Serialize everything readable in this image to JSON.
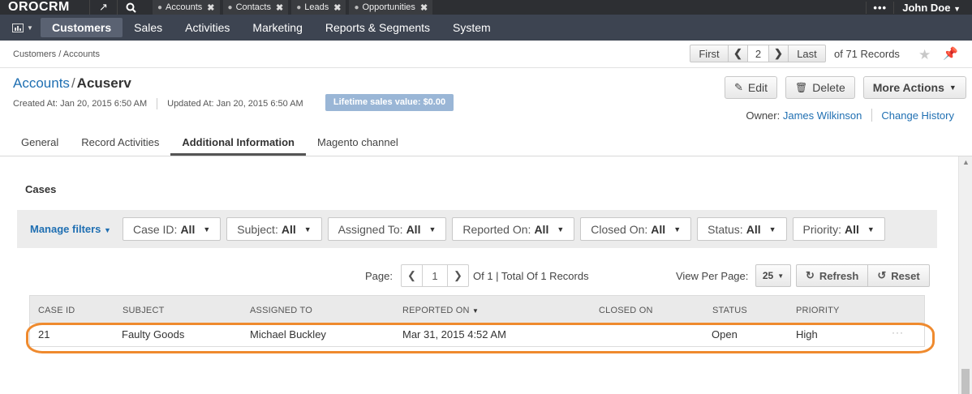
{
  "topbar": {
    "logo": "OROCRM",
    "pins": [
      {
        "label": "Accounts"
      },
      {
        "label": "Contacts"
      },
      {
        "label": "Leads"
      },
      {
        "label": "Opportunities"
      }
    ],
    "user": "John Doe"
  },
  "nav": {
    "items": [
      "Customers",
      "Sales",
      "Activities",
      "Marketing",
      "Reports & Segments",
      "System"
    ]
  },
  "breadcrumb": "Customers / Accounts",
  "pager": {
    "first": "First",
    "page": "2",
    "last": "Last",
    "records": "of 71 Records"
  },
  "entity": {
    "parent": "Accounts",
    "name": "Acuserv",
    "created": "Created At: Jan 20, 2015 6:50 AM",
    "updated": "Updated At: Jan 20, 2015 6:50 AM",
    "lifetime": "Lifetime sales value: $0.00",
    "owner_label": "Owner:",
    "owner": "James Wilkinson",
    "change_history": "Change History"
  },
  "actions": {
    "edit": "Edit",
    "delete": "Delete",
    "more": "More Actions"
  },
  "tabs": [
    "General",
    "Record Activities",
    "Additional Information",
    "Magento channel"
  ],
  "cases": {
    "title": "Cases",
    "manage_filters": "Manage filters",
    "filters": [
      {
        "label": "Case ID:",
        "value": "All"
      },
      {
        "label": "Subject:",
        "value": "All"
      },
      {
        "label": "Assigned To:",
        "value": "All"
      },
      {
        "label": "Reported On:",
        "value": "All"
      },
      {
        "label": "Closed On:",
        "value": "All"
      },
      {
        "label": "Status:",
        "value": "All"
      },
      {
        "label": "Priority:",
        "value": "All"
      }
    ],
    "page_label": "Page:",
    "page_value": "1",
    "page_info": "Of 1 | Total Of 1 Records",
    "view_per_page": "View Per Page:",
    "per_page_value": "25",
    "refresh": "Refresh",
    "reset": "Reset",
    "columns": [
      "Case ID",
      "Subject",
      "Assigned To",
      "Reported On",
      "Closed On",
      "Status",
      "Priority"
    ],
    "rows": [
      {
        "case_id": "21",
        "subject": "Faulty Goods",
        "assigned_to": "Michael Buckley",
        "reported_on": "Mar 31, 2015 4:52 AM",
        "closed_on": "",
        "status": "Open",
        "priority": "High"
      }
    ]
  },
  "colors": {
    "topbar": "#2d2f33",
    "nav": "#3d4451",
    "link": "#1f6fb2",
    "badge": "#9ab6d6",
    "highlight": "#ef8a2e"
  }
}
